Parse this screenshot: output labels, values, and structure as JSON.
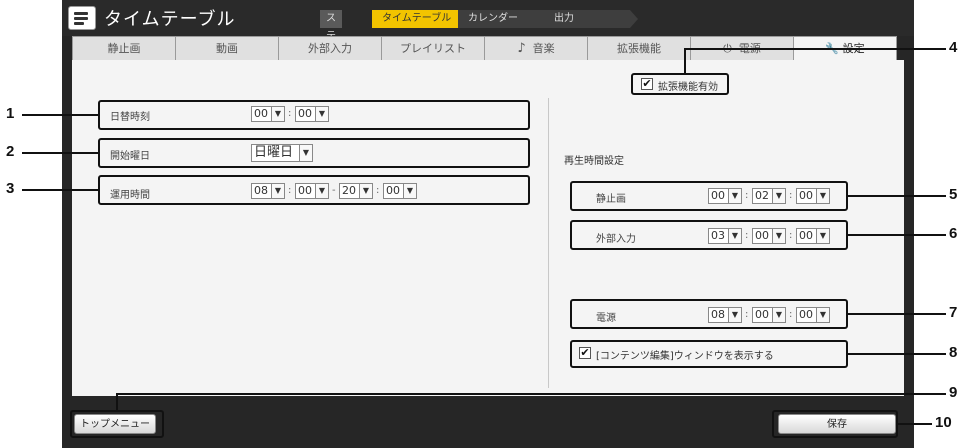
{
  "window": {
    "title": "タイムテーブル"
  },
  "steps": {
    "label": "ステップ",
    "items": [
      "タイムテーブル",
      "カレンダー",
      "出力"
    ],
    "active_index": 0
  },
  "tabs": [
    {
      "label": "静止画",
      "icon": "",
      "active": false
    },
    {
      "label": "動画",
      "icon": "",
      "active": false
    },
    {
      "label": "外部入力",
      "icon": "",
      "active": false
    },
    {
      "label": "プレイリスト",
      "icon": "",
      "active": false
    },
    {
      "label": "音楽",
      "icon": "music-note-icon",
      "active": false
    },
    {
      "label": "拡張機能",
      "icon": "",
      "active": false
    },
    {
      "label": "電源",
      "icon": "power-icon",
      "active": false
    },
    {
      "label": "設定",
      "icon": "wrench-icon",
      "active": true
    }
  ],
  "extension": {
    "label": "拡張機能有効",
    "checked": true
  },
  "left": {
    "date_change": {
      "label": "日替時刻",
      "hour": "00",
      "minute": "00"
    },
    "start_day": {
      "label": "開始曜日",
      "value": "日曜日"
    },
    "operating": {
      "label": "運用時間",
      "start_hour": "08",
      "start_minute": "00",
      "range_sep": "-",
      "end_hour": "20",
      "end_minute": "00"
    }
  },
  "right": {
    "section_title": "再生時間設定",
    "still": {
      "label": "静止画",
      "h": "00",
      "m": "02",
      "s": "00"
    },
    "external": {
      "label": "外部入力",
      "h": "03",
      "m": "00",
      "s": "00"
    },
    "power": {
      "label": "電源",
      "h": "08",
      "m": "00",
      "s": "00"
    },
    "content_edit": {
      "label": "[コンテンツ編集]ウィンドウを表示する",
      "checked": true
    }
  },
  "time_sep": ":",
  "footer": {
    "top_menu": "トップメニュー",
    "save": "保存"
  },
  "callouts": [
    "1",
    "2",
    "3",
    "4",
    "5",
    "6",
    "7",
    "8",
    "9",
    "10"
  ]
}
